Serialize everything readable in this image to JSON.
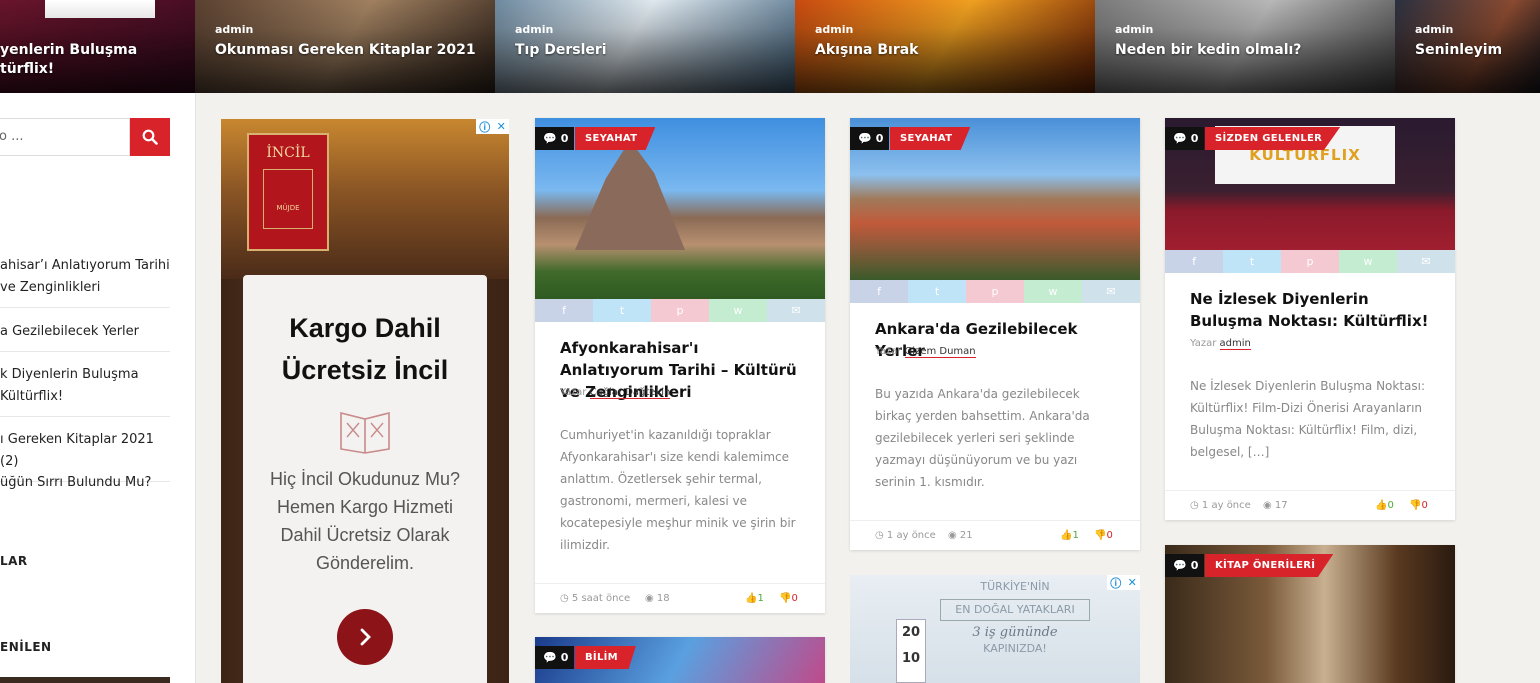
{
  "slider": [
    {
      "author": "",
      "title": "yenlerin Buluşma",
      "title2": "türflix!"
    },
    {
      "author": "admin",
      "title": "Okunması Gereken Kitaplar 2021"
    },
    {
      "author": "admin",
      "title": "Tıp Dersleri"
    },
    {
      "author": "admin",
      "title": "Akışına Bırak"
    },
    {
      "author": "admin",
      "title": "Neden bir kedin olmalı?"
    },
    {
      "author": "admin",
      "title": "Seninleyim"
    }
  ],
  "sidebar": {
    "search_placeholder": "o ...",
    "items": [
      {
        "line1": "ahisar’ı Anlatıyorum Tarihi",
        "line2": " ve Zenginlikleri"
      },
      {
        "line1": "a Gezilebilecek Yerler"
      },
      {
        "line1": "k Diyenlerin Buluşma",
        "line2": "Kültürflix!"
      },
      {
        "line1": "ı Gereken Kitaplar 2021 (2)"
      },
      {
        "line1": "üğün Sırrı Bulundu Mu?"
      }
    ],
    "heading1": "LAR",
    "heading2": "ENİLEN"
  },
  "ad": {
    "book_title": "İNCİL",
    "book_sub": "MÜJDE",
    "headline_line1": "Kargo Dahil",
    "headline_line2": "Ücretsiz İncil",
    "body": "Hiç İncil Okudunuz Mu? Hemen Kargo Hizmeti Dahil Ücretsiz Olarak Gönderelim."
  },
  "cards": [
    {
      "comments": "0",
      "category": "SEYAHAT",
      "title": "Afyonkarahisar'ı Anlatıyorum Tarihi – Kültürü ve Zenginlikleri",
      "by_label": "Yazar",
      "author": "Çağlar Dağtekin",
      "excerpt": "Cumhuriyet'in kazanıldığı topraklar Afyonkarahisar'ı size kendi kalemimce anlattım. Özetlersek şehir termal, gastronomi, mermeri, kalesi ve kocatepesiyle meşhur minik ve şirin bir ilimizdir.",
      "time": "5 saat önce",
      "views": "18",
      "likes": "1",
      "dislikes": "0"
    },
    {
      "comments": "0",
      "category": "SEYAHAT",
      "title": "Ankara'da Gezilebilecek Yerler",
      "by_label": "Yazar",
      "author": "Gizem Duman",
      "excerpt": "Bu yazıda Ankara'da gezilebilecek birkaç yerden bahsettim. Ankara'da gezilebilecek yerleri seri şeklinde yazmayı düşünüyorum ve bu yazı serinin 1. kısmıdır.",
      "time": "1 ay önce",
      "views": "21",
      "likes": "1",
      "dislikes": "0"
    },
    {
      "comments": "0",
      "category": "SİZDEN GELENLER",
      "title": "Ne İzlesek Diyenlerin Buluşma Noktası: Kültürflix!",
      "by_label": "Yazar",
      "author": "admin",
      "excerpt": "Ne İzlesek Diyenlerin Buluşma Noktası: Kültürflix! Film-Dizi Önerisi Arayanların Buluşma Noktası: Kültürflix! Film, dizi, belgesel, […]",
      "time": "1 ay önce",
      "views": "17",
      "likes": "0",
      "dislikes": "0",
      "screen_text": "KÜLTÜRFLIX"
    },
    {
      "comments": "0",
      "category": "BİLİM"
    },
    {
      "comments": "0",
      "category": "KİTAP ÖNERİLERİ"
    }
  ],
  "ad2": {
    "line1": "TÜRKİYE'NİN",
    "line2": "EN DOĞAL YATAKLARI",
    "line3": "3 iş gününde",
    "line4": "KAPINIZDA!",
    "num1": "20",
    "num2": "10"
  },
  "colors": {
    "accent": "#d8232a",
    "like": "#4caa3a"
  }
}
